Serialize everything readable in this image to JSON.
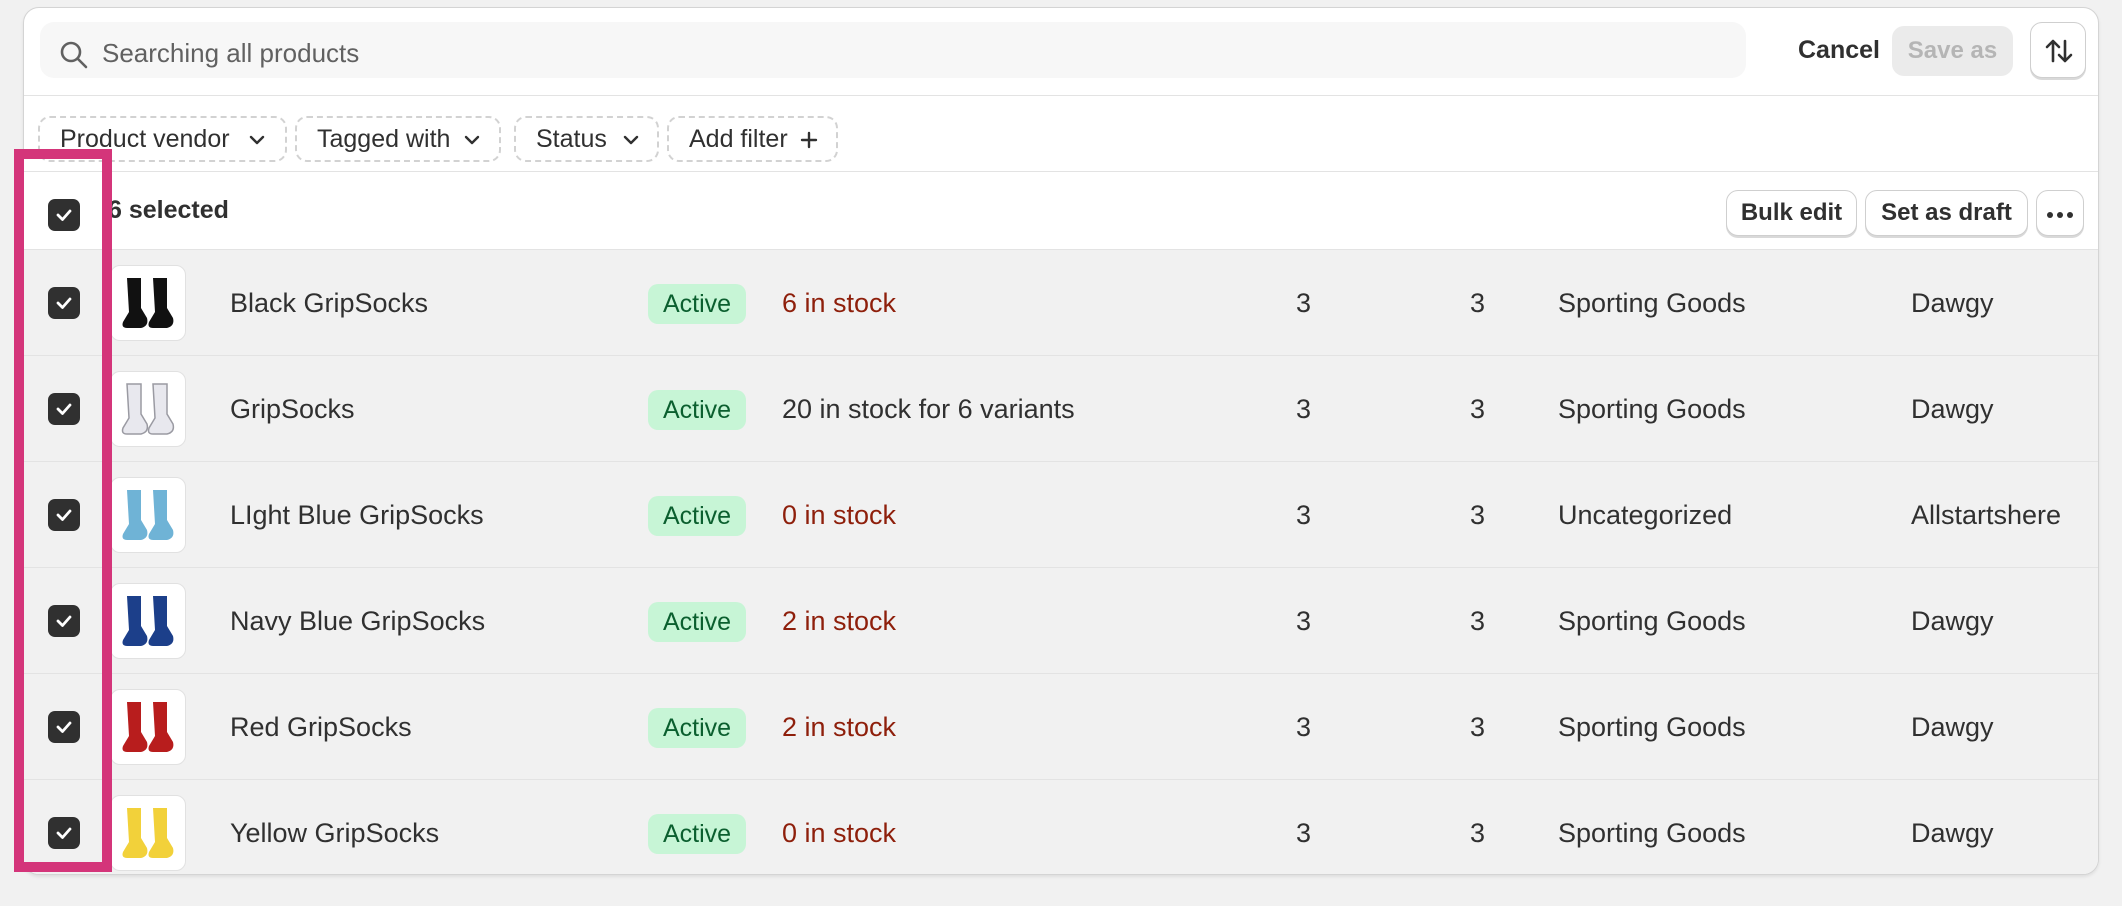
{
  "search": {
    "placeholder": "Searching all products",
    "icon": "search-icon"
  },
  "toolbar": {
    "cancel_label": "Cancel",
    "save_as_label": "Save as",
    "sort_icon": "sort-arrows-icon"
  },
  "filters": [
    {
      "label": "Product vendor"
    },
    {
      "label": "Tagged with"
    },
    {
      "label": "Status"
    },
    {
      "label": "Add filter"
    }
  ],
  "bulk": {
    "selected_label": "6 selected",
    "bulk_edit_label": "Bulk edit",
    "set_draft_label": "Set as draft",
    "more_icon": "more-horizontal-icon"
  },
  "colors": {
    "highlight": "#d4357a",
    "active_badge_bg": "#c7f5d6",
    "active_badge_text": "#0b5f2f",
    "low_stock_text": "#8e1f0b"
  },
  "products": [
    {
      "name": "Black GripSocks",
      "status": "Active",
      "inventory": "6 in stock",
      "col_a": "3",
      "col_b": "3",
      "category": "Sporting Goods",
      "vendor": "Dawgy",
      "sock_color": "#111111",
      "stock_low": true
    },
    {
      "name": "GripSocks",
      "status": "Active",
      "inventory": "20 in stock for 6 variants",
      "col_a": "3",
      "col_b": "3",
      "category": "Sporting Goods",
      "vendor": "Dawgy",
      "sock_color": "#e8e8ee",
      "stock_low": false
    },
    {
      "name": "LIght Blue GripSocks",
      "status": "Active",
      "inventory": "0 in stock",
      "col_a": "3",
      "col_b": "3",
      "category": "Uncategorized",
      "vendor": "Allstartshere",
      "sock_color": "#6fb3d6",
      "stock_low": true
    },
    {
      "name": "Navy Blue GripSocks",
      "status": "Active",
      "inventory": "2 in stock",
      "col_a": "3",
      "col_b": "3",
      "category": "Sporting Goods",
      "vendor": "Dawgy",
      "sock_color": "#1c3f8a",
      "stock_low": true
    },
    {
      "name": "Red GripSocks",
      "status": "Active",
      "inventory": "2 in stock",
      "col_a": "3",
      "col_b": "3",
      "category": "Sporting Goods",
      "vendor": "Dawgy",
      "sock_color": "#b81d1d",
      "stock_low": true
    },
    {
      "name": "Yellow GripSocks",
      "status": "Active",
      "inventory": "0 in stock",
      "col_a": "3",
      "col_b": "3",
      "category": "Sporting Goods",
      "vendor": "Dawgy",
      "sock_color": "#f2d13a",
      "stock_low": true
    }
  ]
}
